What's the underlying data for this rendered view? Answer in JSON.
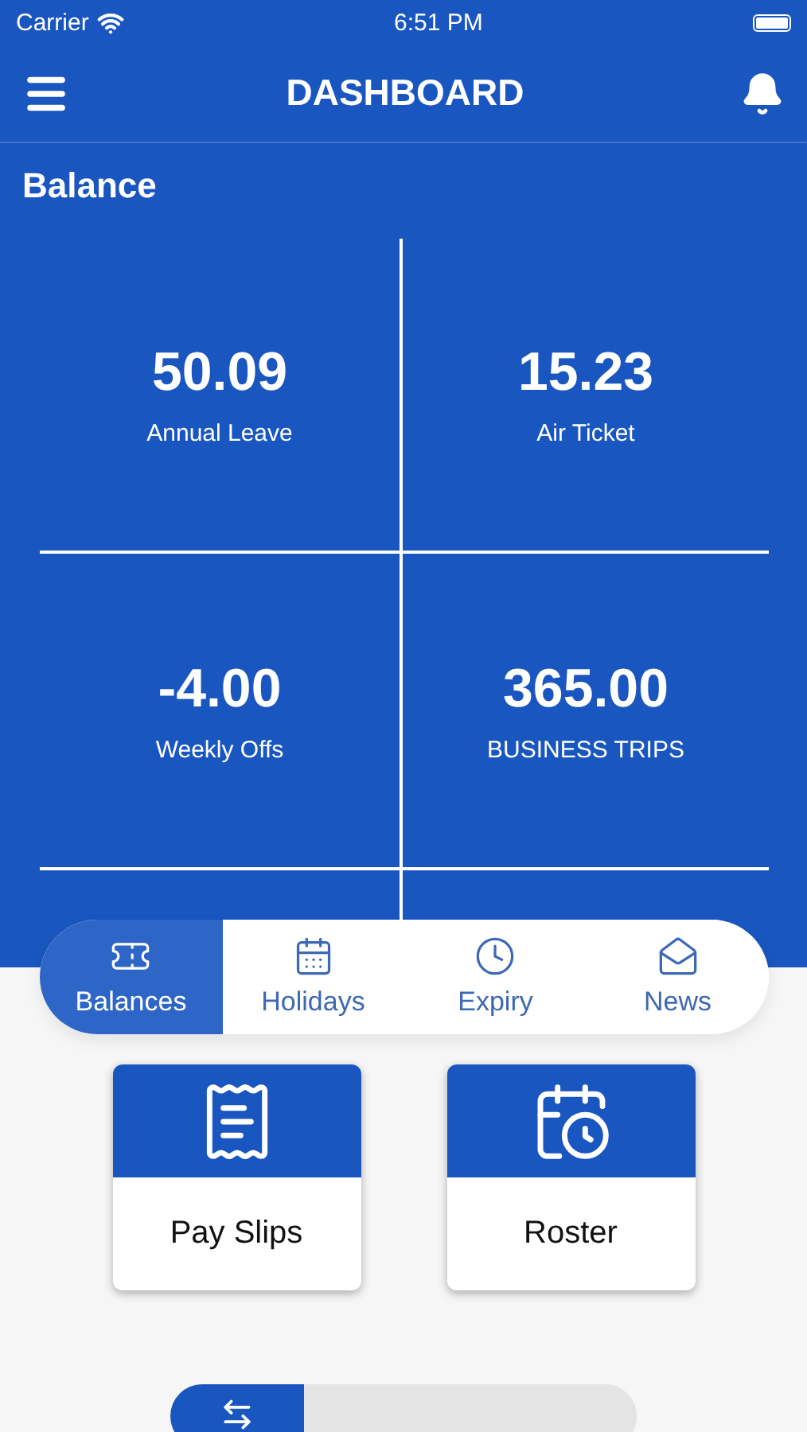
{
  "status_bar": {
    "carrier": "Carrier",
    "time": "6:51 PM"
  },
  "header": {
    "title": "DASHBOARD"
  },
  "balance": {
    "title": "Balance",
    "items": [
      {
        "value": "50.09",
        "label": "Annual Leave"
      },
      {
        "value": "15.23",
        "label": "Air Ticket"
      },
      {
        "value": "-4.00",
        "label": "Weekly Offs"
      },
      {
        "value": "365.00",
        "label": "BUSINESS TRIPS"
      }
    ]
  },
  "tabs": [
    {
      "label": "Balances",
      "selected": true
    },
    {
      "label": "Holidays",
      "selected": false
    },
    {
      "label": "Expiry",
      "selected": false
    },
    {
      "label": "News",
      "selected": false
    }
  ],
  "shortcuts": [
    {
      "label": "Pay Slips"
    },
    {
      "label": "Roster"
    }
  ],
  "bottom_toggle": [
    {
      "selected": true
    },
    {
      "selected": false
    }
  ]
}
